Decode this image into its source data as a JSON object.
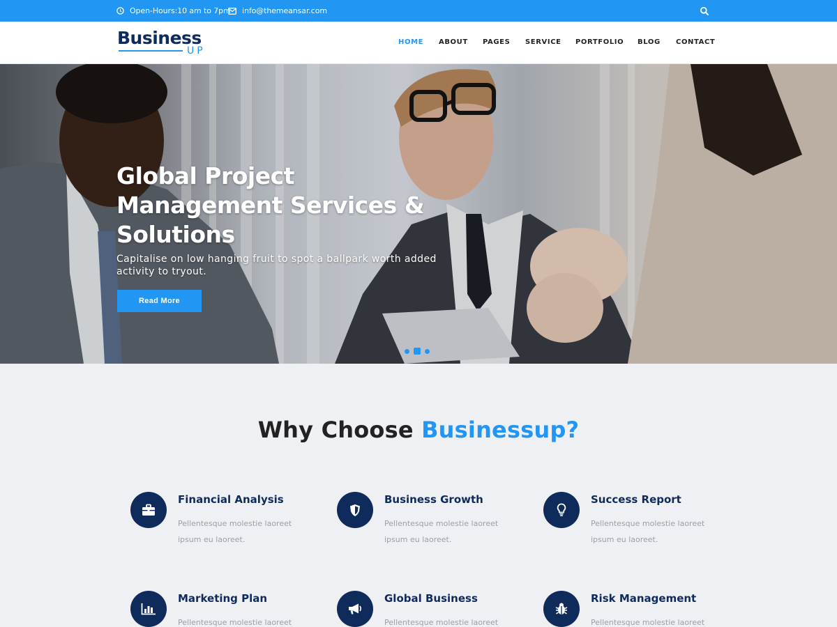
{
  "topbar": {
    "hours": "Open-Hours:10 am to 7pm",
    "email": "info@themeansar.com",
    "icons": {
      "hours": "clock-icon",
      "email": "envelope-icon",
      "search": "search-icon"
    }
  },
  "logo": {
    "main": "Business",
    "sub": "UP"
  },
  "nav": [
    "HOME",
    "ABOUT",
    "PAGES",
    "SERVICE",
    "PORTFOLIO",
    "BLOG",
    "CONTACT"
  ],
  "nav_active": "HOME",
  "hero": {
    "title": "Global Project Management Services & Solutions",
    "subtitle": "Capitalise on low hanging fruit to spot a ballpark worth added activity to tryout.",
    "button": "Read More",
    "slides": 3,
    "active_slide": 2
  },
  "section": {
    "title_part1": "Why Choose ",
    "title_accent": "Businessup?"
  },
  "features": [
    {
      "title": "Financial Analysis",
      "desc": "Pellentesque molestie laoreet ipsum eu laoreet.",
      "icon": "briefcase-icon"
    },
    {
      "title": "Business Growth",
      "desc": "Pellentesque molestie laoreet ipsum eu laoreet.",
      "icon": "shield-icon"
    },
    {
      "title": "Success Report",
      "desc": "Pellentesque molestie laoreet ipsum eu laoreet.",
      "icon": "lightbulb-icon"
    },
    {
      "title": "Marketing Plan",
      "desc": "Pellentesque molestie laoreet",
      "icon": "bar-chart-icon"
    },
    {
      "title": "Global Business",
      "desc": "Pellentesque molestie laoreet",
      "icon": "megaphone-icon"
    },
    {
      "title": "Risk Management",
      "desc": "Pellentesque molestie laoreet",
      "icon": "bug-icon"
    }
  ],
  "colors": {
    "accent": "#2196f3",
    "navy": "#0e2b5c",
    "background": "#eef0f3"
  }
}
